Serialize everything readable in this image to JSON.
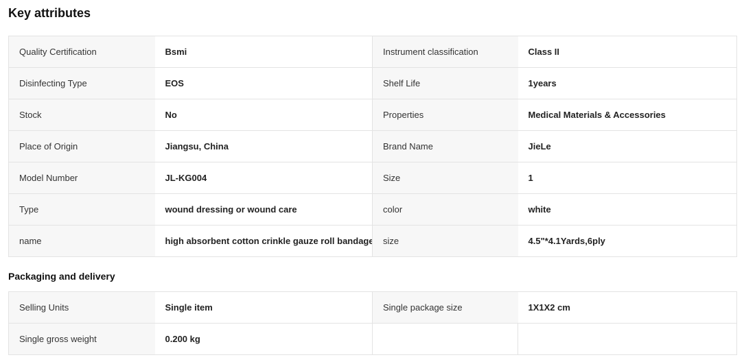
{
  "key_attributes": {
    "title": "Key attributes",
    "rows": [
      [
        {
          "label": "Quality Certification",
          "value": "Bsmi"
        },
        {
          "label": "Instrument classification",
          "value": "Class II"
        }
      ],
      [
        {
          "label": "Disinfecting Type",
          "value": "EOS"
        },
        {
          "label": "Shelf Life",
          "value": "1years"
        }
      ],
      [
        {
          "label": "Stock",
          "value": "No"
        },
        {
          "label": "Properties",
          "value": "Medical Materials & Accessories"
        }
      ],
      [
        {
          "label": "Place of Origin",
          "value": "Jiangsu, China"
        },
        {
          "label": "Brand Name",
          "value": "JieLe"
        }
      ],
      [
        {
          "label": "Model Number",
          "value": "JL-KG004"
        },
        {
          "label": "Size",
          "value": "1"
        }
      ],
      [
        {
          "label": "Type",
          "value": "wound dressing or wound care"
        },
        {
          "label": "color",
          "value": "white"
        }
      ],
      [
        {
          "label": "name",
          "value": "high absorbent cotton crinkle gauze roll bandage"
        },
        {
          "label": "size",
          "value": "4.5\"*4.1Yards,6ply"
        }
      ]
    ]
  },
  "packaging": {
    "title": "Packaging and delivery",
    "rows": [
      [
        {
          "label": "Selling Units",
          "value": "Single item"
        },
        {
          "label": "Single package size",
          "value": "1X1X2 cm"
        }
      ],
      [
        {
          "label": "Single gross weight",
          "value": "0.200 kg"
        },
        {
          "label": "",
          "value": ""
        }
      ]
    ]
  }
}
